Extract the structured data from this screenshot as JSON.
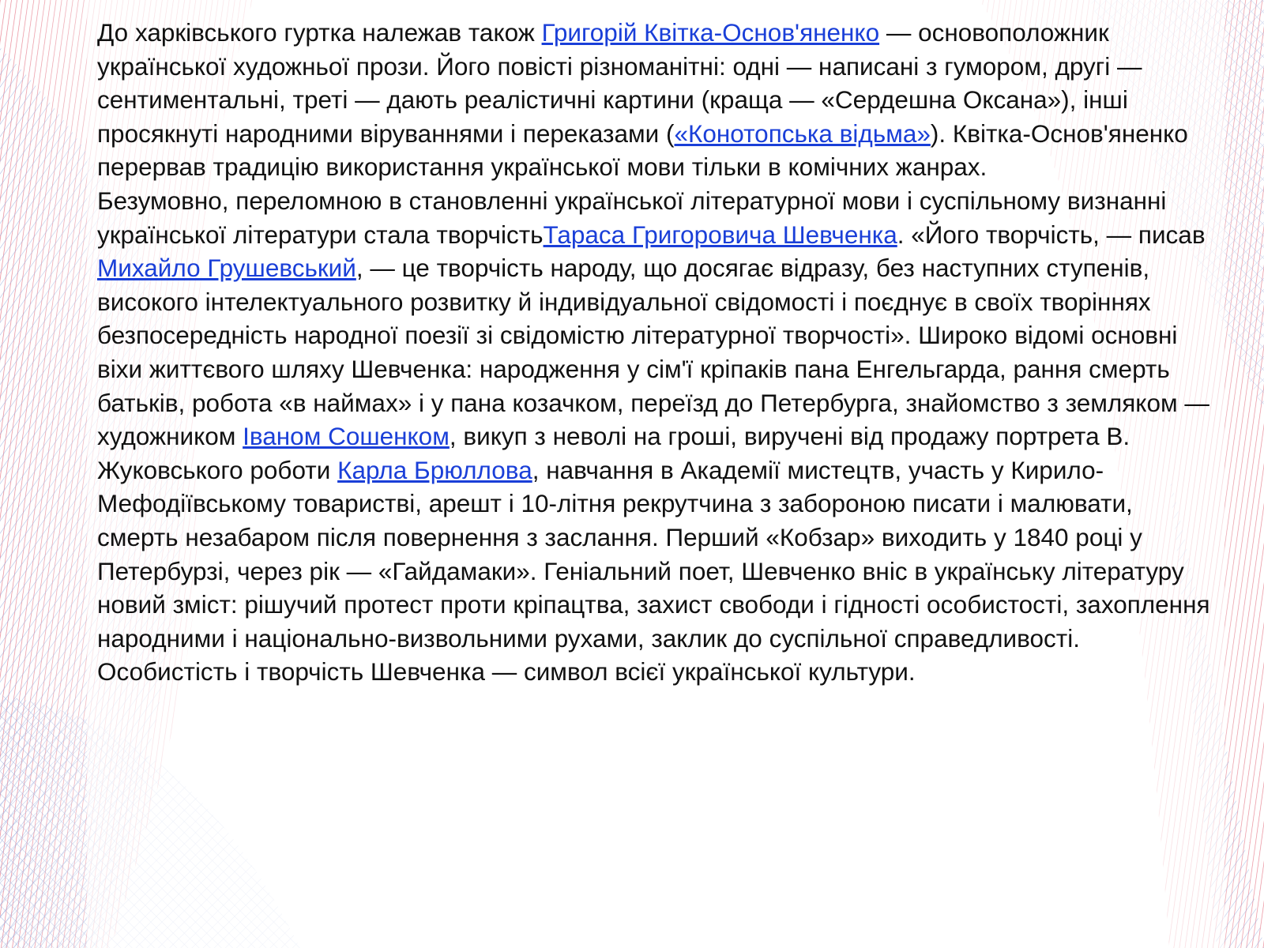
{
  "slide": {
    "paragraph1": {
      "t1": "До харківського гуртка належав також ",
      "link1": "Григорій Квітка-Основ'яненко",
      "t2": " — основоположник української художньої прози. Його повісті різноманітні: одні — написані з гумором, другі — сентиментальні, треті — дають реалістичні картини (краща — «Сердешна Оксана»), інші просякнуті народними віруваннями і переказами (",
      "link2": "«Конотопська відьма»",
      "t3": "). Квітка-Основ'яненко перервав традицію використання української мови тільки в комічних жанрах."
    },
    "paragraph2": {
      "t1": "Безумовно, переломною в становленні української літературної мови і суспільному визнанні української літератури стала творчість",
      "link1": "Тараса Григоровича Шевченка",
      "t2": ". «Його творчість, — писав ",
      "link2": "Михайло Грушевський",
      "t3": ", — це творчість народу, що досягає відразу, без наступних ступенів, високого інтелектуального розвитку й індивідуальної свідомості і поєднує в своїх творіннях безпосередність народної поезії зі свідомістю літературної творчості». Широко відомі основні віхи життєвого шляху Шевченка: народження у сім'ї кріпаків пана Енгельгарда, рання смерть батьків, робота «в наймах» і у пана козачком, переїзд до Петербурга, знайомство з земляком — художником ",
      "link3": "Іваном Сошенком",
      "t4": ", викуп з неволі на гроші, виручені від продажу портрета В. Жуковського роботи ",
      "link4": "Карла Брюллова",
      "t5": ", навчання в Академії мистецтв, участь у Кирило-Мефодіївському товаристві, арешт і 10-літня рекрутчина з забороною писати і малювати, смерть незабаром після повернення з заслання. Перший «Кобзар» виходить у 1840 році у Петербурзі, через рік — «Гайдамаки». Геніальний поет, Шевченко вніс в українську літературу новий зміст: рішучий протест проти кріпацтва, захист свободи і гідності особистості, захоплення народними і національно-визвольними рухами, заклик до суспільної справедливості. Особистість і творчість Шевченка — символ всієї української культури."
    }
  },
  "colors": {
    "text": "#111111",
    "link": "#1a3fd8",
    "mesh_red": "#e0566a",
    "mesh_blue": "#8aa0d8"
  }
}
